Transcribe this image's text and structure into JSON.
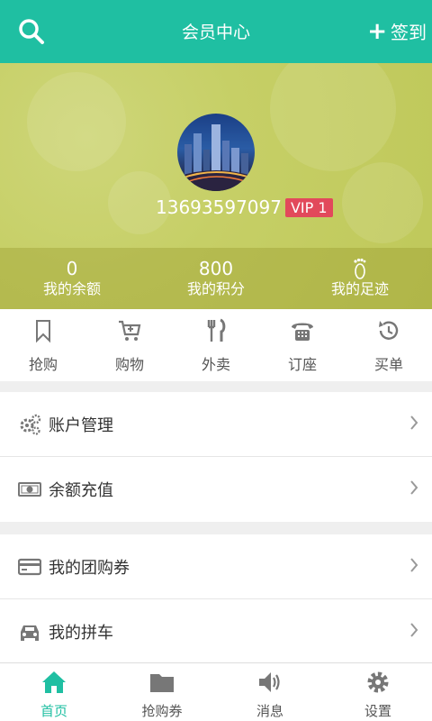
{
  "header": {
    "title": "会员中心",
    "checkin_label": "签到",
    "accent": "#1fbfa2"
  },
  "profile": {
    "phone": "13693597097",
    "vip": "VIP 1"
  },
  "stats": [
    {
      "value": "0",
      "label": "我的余额"
    },
    {
      "value": "800",
      "label": "我的积分"
    },
    {
      "label": "我的足迹",
      "icon": "footprint-icon"
    }
  ],
  "quick_actions": [
    {
      "label": "抢购",
      "icon": "bookmark-icon"
    },
    {
      "label": "购物",
      "icon": "cart-icon"
    },
    {
      "label": "外卖",
      "icon": "utensils-icon"
    },
    {
      "label": "订座",
      "icon": "phone-icon"
    },
    {
      "label": "买单",
      "icon": "history-icon"
    }
  ],
  "menu1": [
    {
      "label": "账户管理",
      "icon": "gears-icon"
    },
    {
      "label": "余额充值",
      "icon": "money-icon"
    }
  ],
  "menu2": [
    {
      "label": "我的团购券",
      "icon": "card-icon"
    },
    {
      "label": "我的拼车",
      "icon": "car-icon"
    }
  ],
  "tabbar": [
    {
      "label": "首页",
      "icon": "home-icon",
      "active": true
    },
    {
      "label": "抢购券",
      "icon": "folder-icon"
    },
    {
      "label": "消息",
      "icon": "volume-icon"
    },
    {
      "label": "设置",
      "icon": "gear-icon"
    }
  ]
}
